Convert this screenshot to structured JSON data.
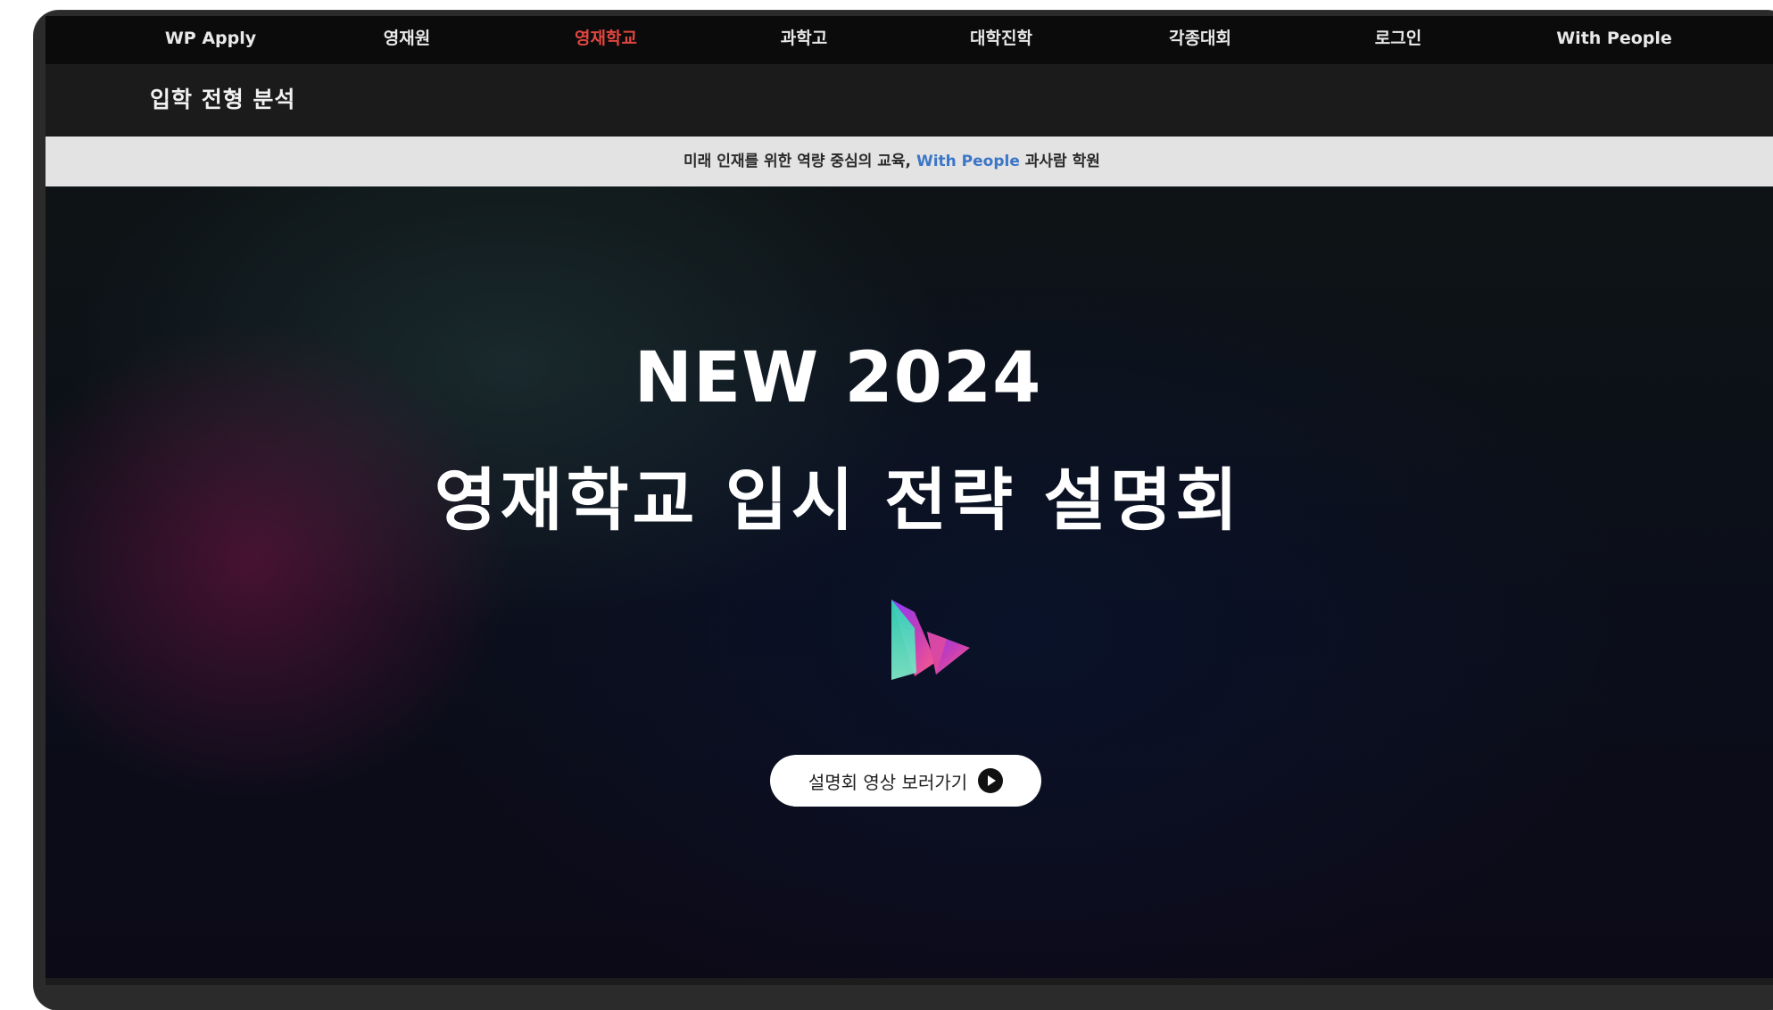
{
  "nav": {
    "items": [
      {
        "label": "WP Apply"
      },
      {
        "label": "영재원"
      },
      {
        "label": "영재학교"
      },
      {
        "label": "과학고"
      },
      {
        "label": "대학진학"
      },
      {
        "label": "각종대회"
      },
      {
        "label": "로그인"
      },
      {
        "label": "With People"
      }
    ],
    "active_label": "영재학교"
  },
  "subbar": {
    "title": "입학 전형 분석"
  },
  "banner": {
    "text_before": "미래 인재를 위한 역량 중심의 교육, ",
    "highlight": "With People",
    "text_after": " 과사람 학원"
  },
  "hero": {
    "line1": "NEW 2024",
    "line2": "영재학교 입시 전략 설명회",
    "logo_icon": "wp-logo-icon",
    "cta_label": "설명회 영상 보러가기",
    "cta_icon": "play-circle-icon"
  },
  "colors": {
    "nav_bg": "#0b0b0b",
    "active_nav": "#e0463f",
    "banner_bg": "#e3e3e3",
    "banner_accent": "#3b76c7",
    "hero_bg": "#0b0e1a"
  }
}
